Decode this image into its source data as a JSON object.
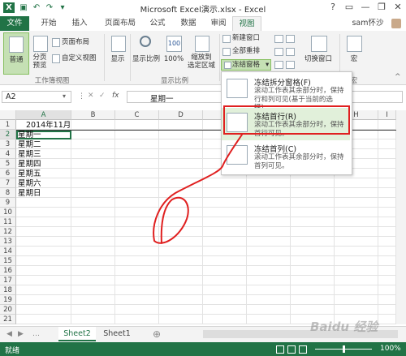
{
  "window": {
    "title": "Microsoft Excel演示.xlsx - Excel",
    "help": "?",
    "minimize": "—",
    "restore": "❐",
    "close": "✕"
  },
  "tabs": [
    "文件",
    "开始",
    "插入",
    "页面布局",
    "公式",
    "数据",
    "审阅",
    "视图"
  ],
  "user": "sam怀沙",
  "ribbon": {
    "normal": "普通",
    "page_break": "分页\n预览",
    "page_layout": "页面布局",
    "custom_views": "自定义视图",
    "group_workbook_views": "工作簿视图",
    "show": "显示",
    "zoom": "显示比例",
    "zoom_100": "100%",
    "zoom_selection": "缩放到\n选定区域",
    "group_zoom": "显示比例",
    "new_window": "新建窗口",
    "arrange_all": "全部重排",
    "freeze_panes": "冻结窗格",
    "switch_windows": "切换窗口",
    "macros": "宏",
    "group_macros": "宏"
  },
  "formula_bar": {
    "name_box": "A2",
    "fx": "fx",
    "content": "星期一"
  },
  "dropdown": {
    "items": [
      {
        "title": "冻结拆分窗格(F)",
        "desc": "滚动工作表其余部分时，保持行和列可见(基于当前的选择)。"
      },
      {
        "title": "冻结首行(R)",
        "desc": "滚动工作表其余部分时，保持首行可见。"
      },
      {
        "title": "冻结首列(C)",
        "desc": "滚动工作表其余部分时，保持首列可见。"
      }
    ]
  },
  "sheet": {
    "columns": [
      "A",
      "B",
      "C",
      "D",
      "E",
      "F",
      "G",
      "H",
      "I"
    ],
    "rows": [
      "1",
      "2",
      "3",
      "4",
      "5",
      "6",
      "7",
      "8",
      "9",
      "10",
      "11",
      "12",
      "13",
      "14",
      "15",
      "16",
      "17",
      "18",
      "19",
      "20",
      "21"
    ],
    "cells": [
      "2014年11月",
      "星期一",
      "星期二",
      "星期三",
      "星期四",
      "星期五",
      "星期六",
      "星期日"
    ]
  },
  "sheet_tabs": {
    "active": "Sheet2",
    "other": "Sheet1",
    "add": "⊕"
  },
  "status": {
    "ready": "就绪",
    "zoom": "100%"
  },
  "watermark": "Baidu 经验",
  "colors": {
    "accent": "#217346",
    "annotation": "#e02020"
  }
}
